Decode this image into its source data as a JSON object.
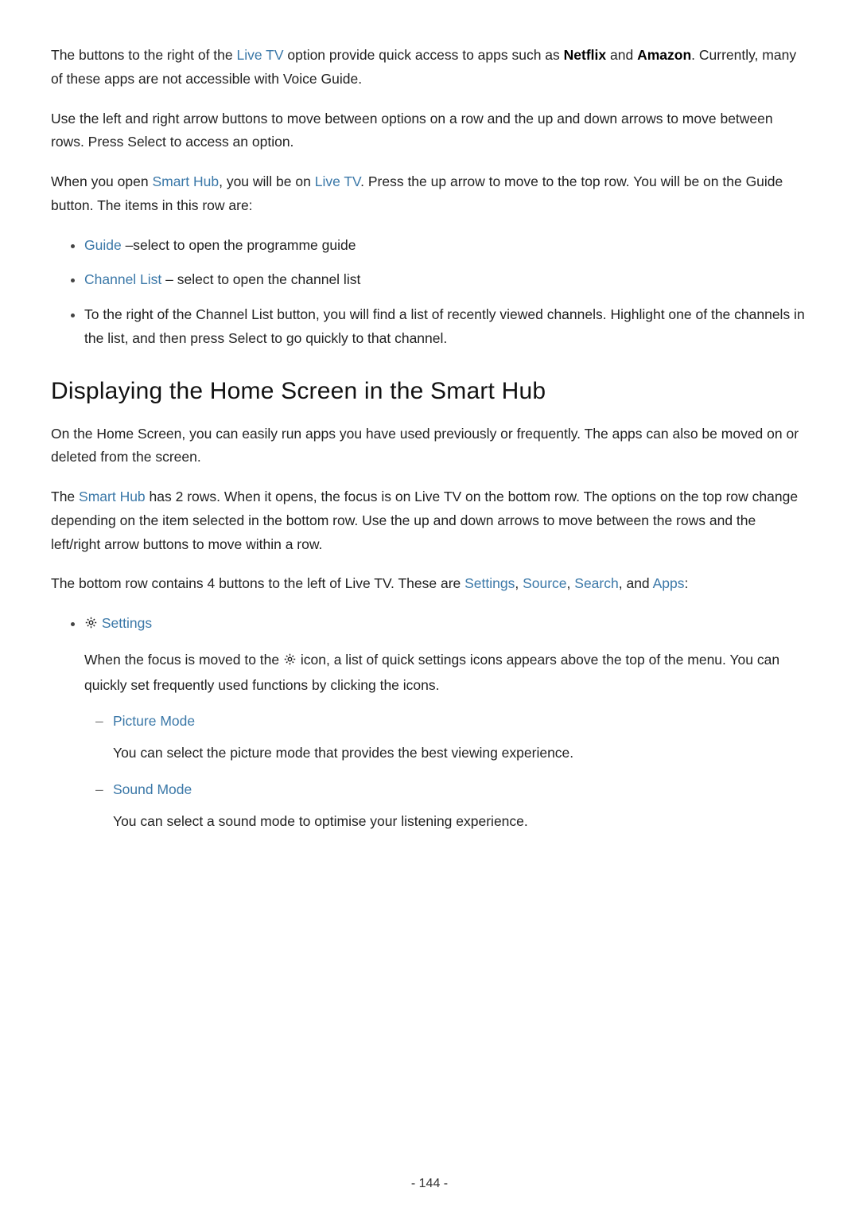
{
  "para1": {
    "t1": "The buttons to the right of the ",
    "link1": "Live TV",
    "t2": " option provide quick access to apps such as ",
    "b1": "Netflix",
    "t3": " and ",
    "b2": "Amazon",
    "t4": ". Currently, many of these apps are not accessible with Voice Guide."
  },
  "para2": "Use the left and right arrow buttons to move between options on a row and the up and down arrows to move between rows. Press Select to access an option.",
  "para3": {
    "t1": "When you open ",
    "link1": "Smart Hub",
    "t2": ", you will be on ",
    "link2": "Live TV",
    "t3": ". Press the up arrow to move to the top row. You will be on the Guide button. The items in this row are:"
  },
  "bullets1": {
    "b1_link": "Guide",
    "b1_text": " –select to open the programme guide",
    "b2_link": "Channel List",
    "b2_text": " – select to open the channel list",
    "b3_text": "To the right of the Channel List button, you will find a list of recently viewed channels. Highlight one of the channels in the list, and then press Select to go quickly to that channel."
  },
  "heading": "Displaying the Home Screen in the Smart Hub",
  "para4": "On the Home Screen, you can easily run apps you have used previously or frequently. The apps can also be moved on or deleted from the screen.",
  "para5": {
    "t1": "The ",
    "link1": "Smart Hub",
    "t2": " has 2 rows. When it opens, the focus is on Live TV on the bottom row. The options on the top row change depending on the item selected in the bottom row. Use the up and down arrows to move between the rows and the left/right arrow buttons to move within a row."
  },
  "para6": {
    "t1": "The bottom row contains 4 buttons to the left of Live TV. These are ",
    "link1": "Settings",
    "sep1": ", ",
    "link2": "Source",
    "sep2": ", ",
    "link3": "Search",
    "sep3": ", and ",
    "link4": "Apps",
    "tail": ":"
  },
  "settings": {
    "label": "Settings",
    "desc_t1": "When the focus is moved to the ",
    "desc_t2": " icon, a list of quick settings icons appears above the top of the menu. You can quickly set frequently used functions by clicking the icons.",
    "picture_mode_label": "Picture Mode",
    "picture_mode_desc": "You can select the picture mode that provides the best viewing experience.",
    "sound_mode_label": "Sound Mode",
    "sound_mode_desc": "You can select a sound mode to optimise your listening experience."
  },
  "page_number": "- 144 -"
}
